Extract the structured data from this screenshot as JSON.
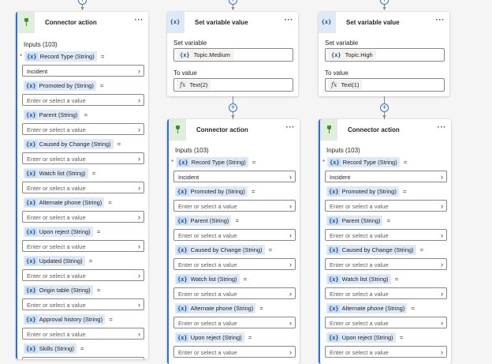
{
  "connector_card": {
    "title": "Connector action",
    "more": "···",
    "inputs_label": "Inputs (103)",
    "placeholder": "Enter or select a value",
    "record_type_value": "Incident",
    "params_left": [
      "Record Type (String)",
      "Promoted by (String)",
      "Parent (String)",
      "Caused by Change (String)",
      "Watch list (String)",
      "Alternate phone (String)",
      "Upon reject (String)",
      "Updated (String)",
      "Origin table (String)",
      "Approval history (String)",
      "Skills (String)"
    ],
    "params_right": [
      "Record Type (String)",
      "Promoted by (String)",
      "Parent (String)",
      "Caused by Change (String)",
      "Watch list (String)",
      "Alternate phone (String)",
      "Upon reject (String)"
    ]
  },
  "set_variable_cards": [
    {
      "title": "Set variable value",
      "set_label": "Set variable",
      "variable": "Topic.Medium",
      "to_label": "To value",
      "value": "Text(2)"
    },
    {
      "title": "Set variable value",
      "set_label": "Set variable",
      "variable": "Topic.High",
      "to_label": "To value",
      "value": "Text(1)"
    }
  ],
  "symbols": {
    "var": "{x}",
    "fx": "fx",
    "eq": "=",
    "chevron": "›",
    "plus": "+",
    "arrow": "▼"
  },
  "colors": {
    "accent": "#2a6fdb",
    "connector_icon": "#3b8f2c",
    "variable_tag": "#dde9f7"
  }
}
